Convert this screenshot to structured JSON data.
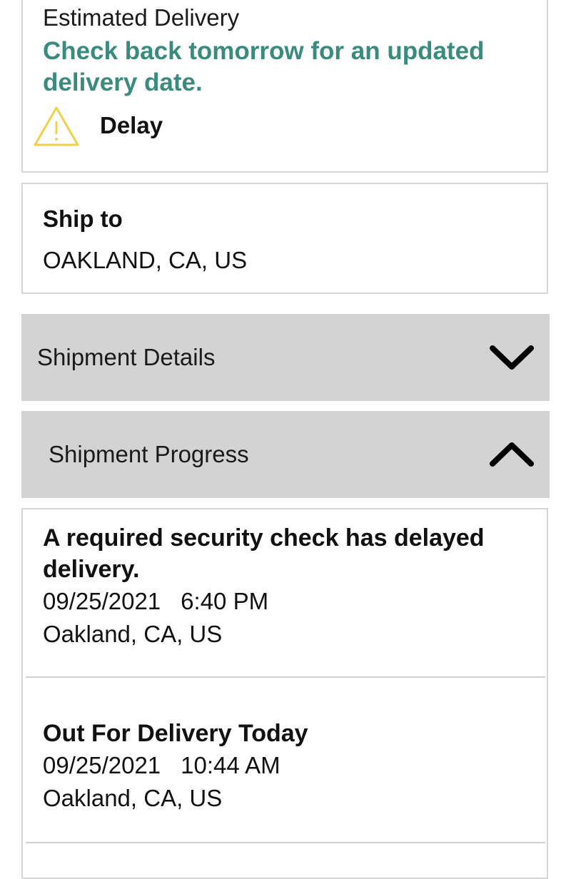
{
  "delivery": {
    "label": "Estimated Delivery",
    "message": "Check back tomorrow for an updated delivery date.",
    "status": "Delay",
    "status_icon": "warning-icon",
    "accent_color": "#3a8a7e",
    "warning_color": "#f2cf4a"
  },
  "ship_to": {
    "title": "Ship to",
    "address": "OAKLAND, CA, US"
  },
  "sections": {
    "details": {
      "label": "Shipment Details",
      "icon": "chevron-down-icon"
    },
    "progress": {
      "label": "Shipment Progress",
      "icon": "chevron-up-icon"
    }
  },
  "progress_events": [
    {
      "title": "A required security check has delayed delivery.",
      "date": "09/25/2021",
      "time": "6:40 PM",
      "location": "Oakland, CA, US"
    },
    {
      "title": "Out For Delivery Today",
      "date": "09/25/2021",
      "time": "10:44 AM",
      "location": "Oakland, CA, US"
    }
  ]
}
